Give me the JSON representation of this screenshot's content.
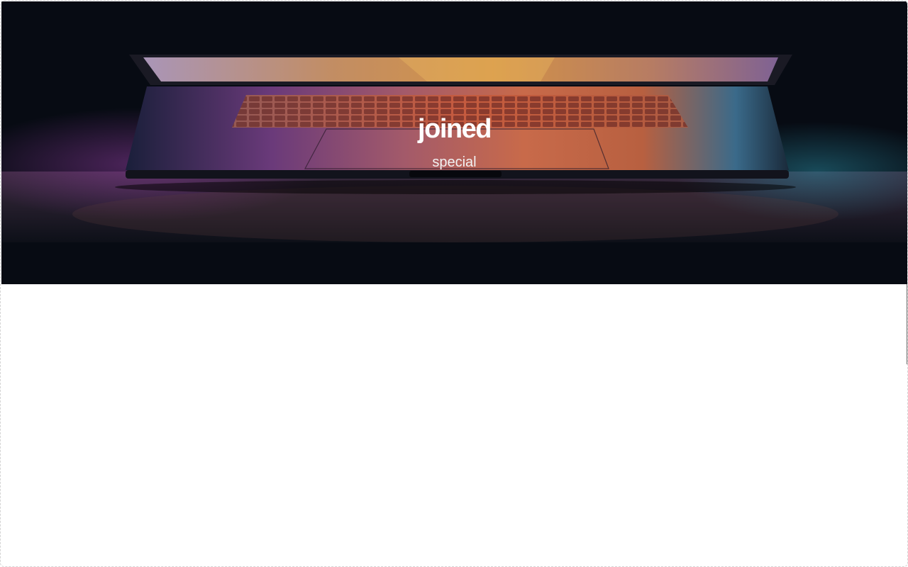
{
  "hero": {
    "title": "joined",
    "subtitle": "special",
    "image": "laptop-keyboard-photo"
  },
  "colors": {
    "hero_background": "#070b13",
    "text": "#ffffff"
  }
}
